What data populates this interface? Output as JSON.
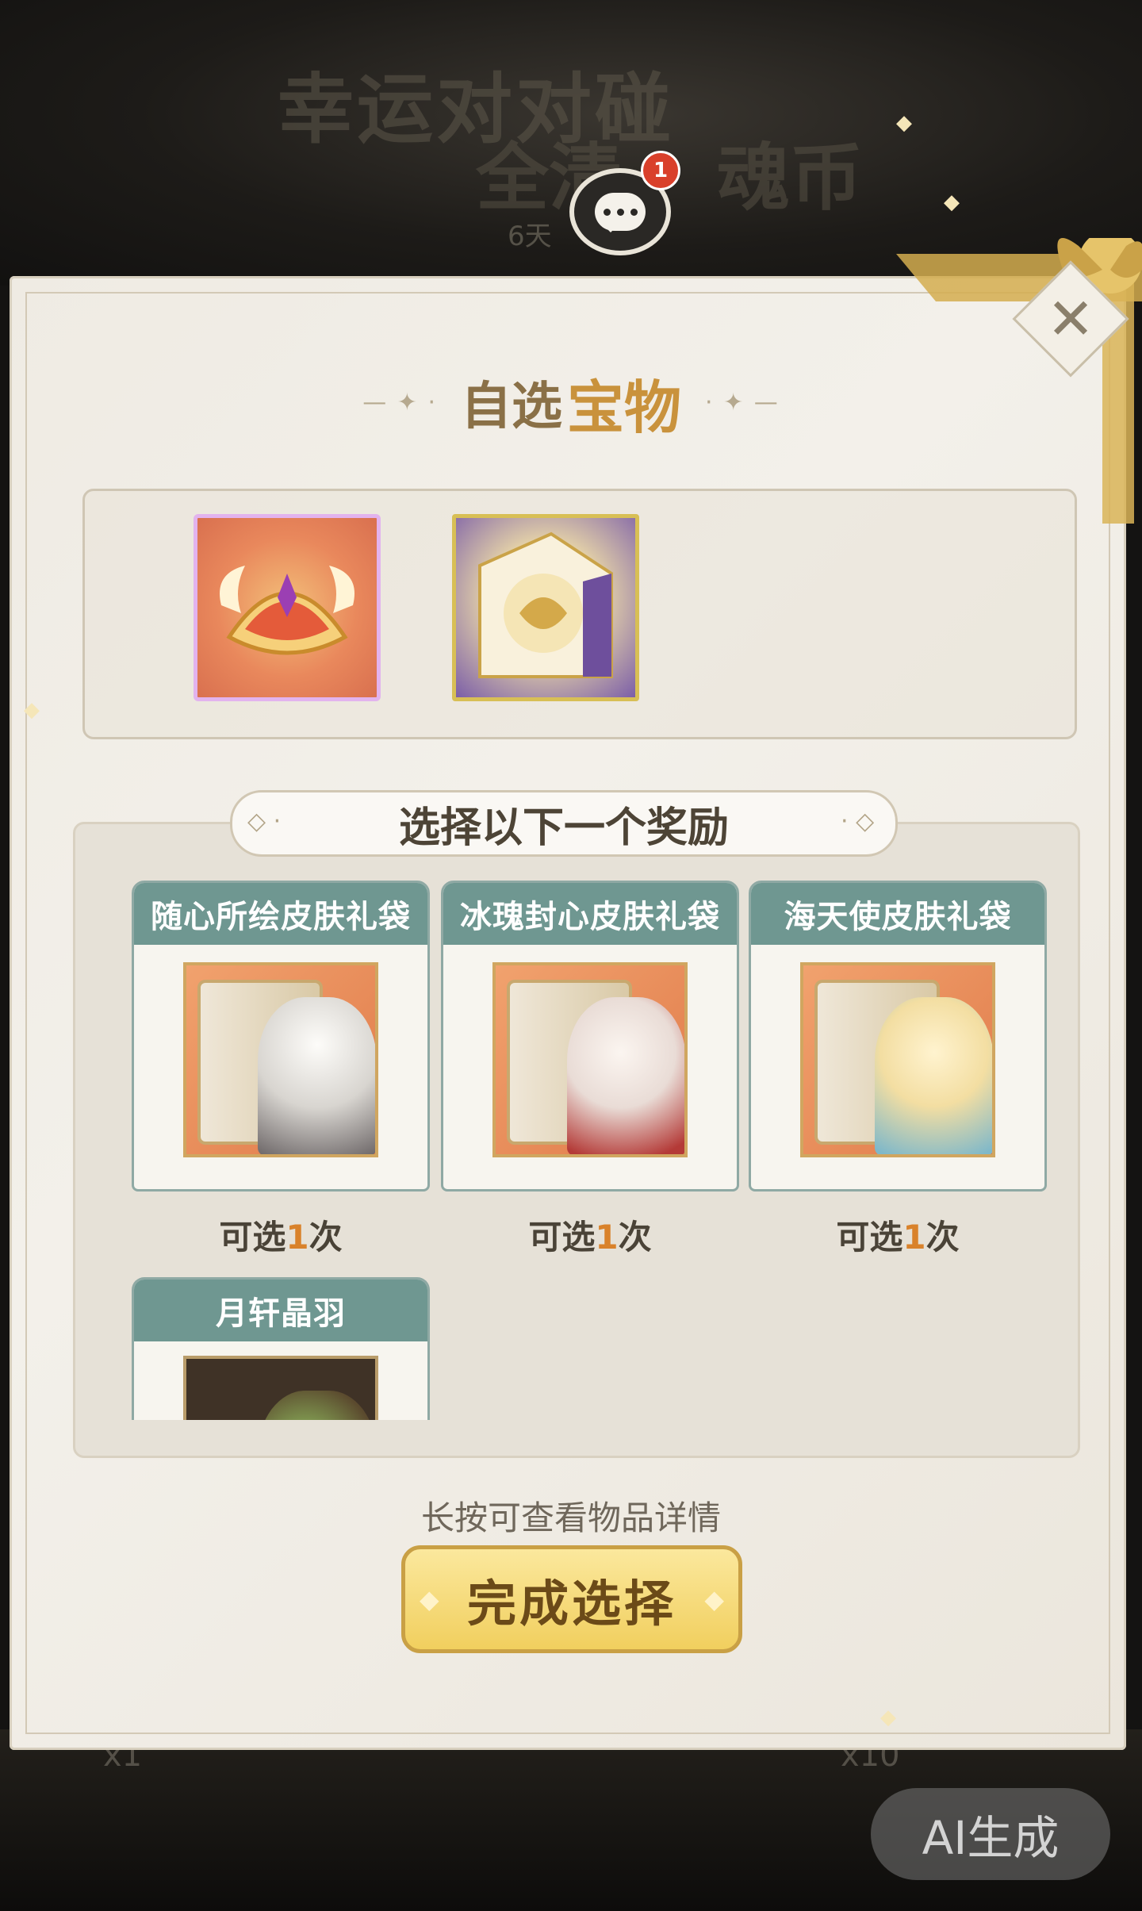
{
  "background": {
    "title_line1": "幸运对对碰",
    "title_line2": "全清",
    "title_line2b": "魂币",
    "subtitle": "6天",
    "badge_left": "x1",
    "badge_right": "x10"
  },
  "chat": {
    "badge_count": "1"
  },
  "dialog": {
    "title_part1": "自选",
    "title_part2": "宝物",
    "rewards_header": "选择以下一个奖励",
    "hint": "长按可查看物品详情",
    "confirm_label": "完成选择",
    "close_label": "✕"
  },
  "rewards": [
    {
      "title": "随心所绘皮肤礼袋",
      "count_prefix": "可选",
      "count": "1",
      "count_suffix": "次"
    },
    {
      "title": "冰瑰封心皮肤礼袋",
      "count_prefix": "可选",
      "count": "1",
      "count_suffix": "次"
    },
    {
      "title": "海天使皮肤礼袋",
      "count_prefix": "可选",
      "count": "1",
      "count_suffix": "次"
    },
    {
      "title": "月轩晶羽"
    }
  ],
  "watermark": "AI生成",
  "colors": {
    "accent_gold": "#c9923c",
    "card_header": "#6f9791",
    "count_number": "#d9822b",
    "selected_border": "#e2b3ee"
  }
}
